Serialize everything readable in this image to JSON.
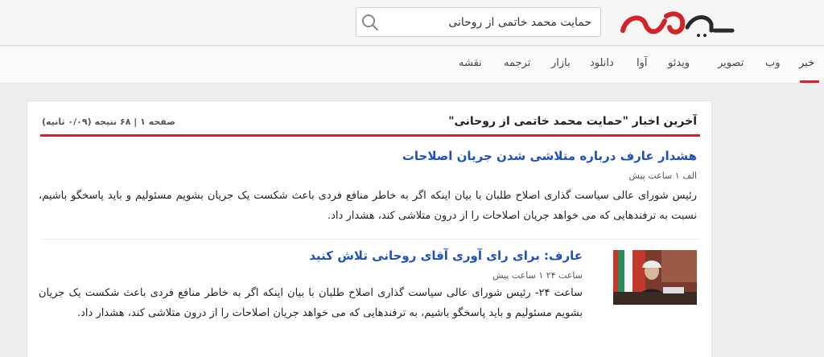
{
  "header": {
    "logo_text": "یارجو",
    "logo_subtext": "خبر",
    "search": {
      "value": "حمایت محمد خاتمی از روحانی",
      "placeholder": ""
    }
  },
  "nav": {
    "items": [
      {
        "label": "خبر",
        "active": true
      },
      {
        "label": "وب"
      },
      {
        "label": "تصویر"
      },
      {
        "label": "ویدئو"
      },
      {
        "label": "آوا"
      },
      {
        "label": "دانلود"
      },
      {
        "label": "بازار"
      },
      {
        "label": "ترجمه"
      },
      {
        "label": "نقشه"
      }
    ]
  },
  "results": {
    "heading": "آخرین اخبار \"حمایت محمد خاتمی از روحانی\"",
    "meta": "صفحه ۱ | ۶۸ نتیجه (۰/۰۹ ثانیه)",
    "items": [
      {
        "title": "هشدار عارف درباره متلاشی شدن جریان اصلاحات",
        "source": "الف   ۱ ساعت پیش",
        "body": "رئیس شورای عالی سیاست گذاری اصلاح طلبان با بیان اینکه اگر به خاطر منافع فردی باعث شکست یک جریان بشویم مسئولیم و باید پاسخگو باشیم، نسبت به ترفندهایی که می خواهد جریان اصلاحات را از درون متلاشی کند، هشدار داد."
      },
      {
        "title": "عارف: برای رای آوری آقای روحانی تلاش کنید",
        "source": "ساعت ۲۴   ۱ ساعت پیش",
        "body": "ساعت ۲۴- رئیس شورای عالی سیاست گذاری اصلاح طلبان با بیان اینکه اگر به خاطر منافع فردی باعث شکست یک جریان بشویم مسئولیم و باید پاسخگو باشیم، به ترفندهایی که می خواهد جریان اصلاحات را از درون متلاشی کند، هشدار داد."
      }
    ]
  },
  "colors": {
    "brand_red": "#d3232a",
    "link_blue": "#1f4fc4"
  }
}
